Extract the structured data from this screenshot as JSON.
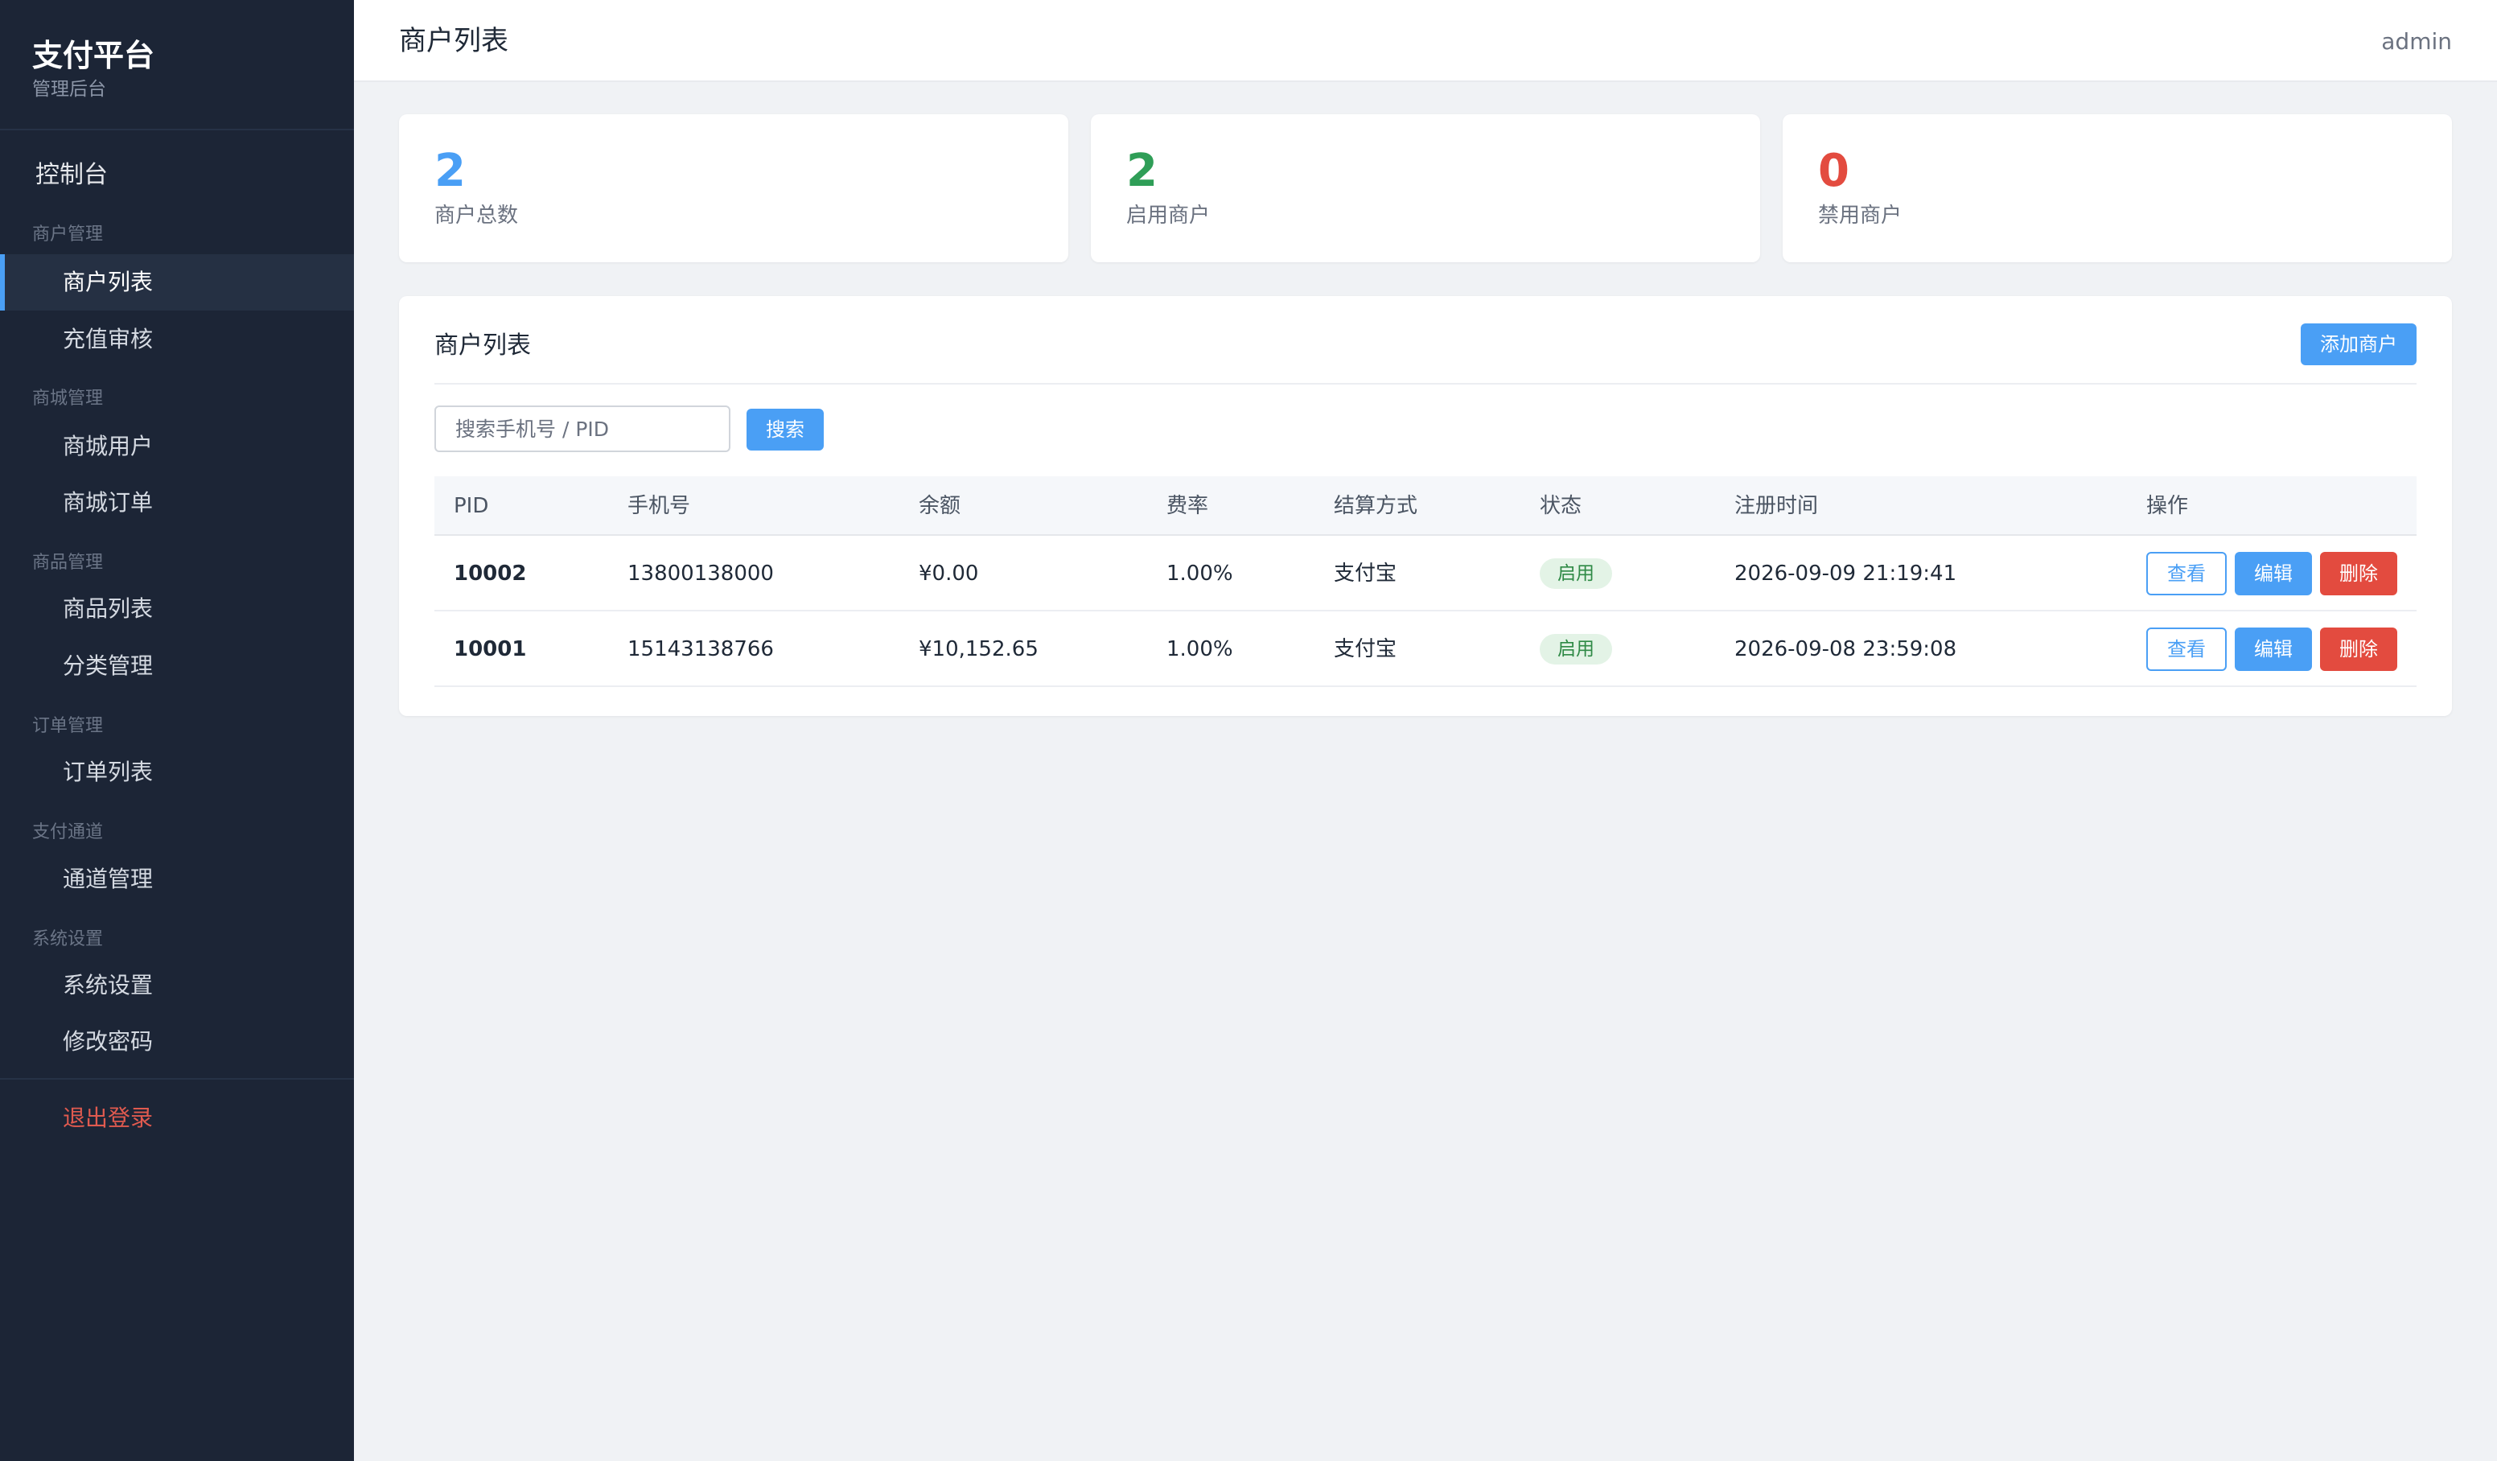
{
  "sidebar": {
    "brand_title": "支付平台",
    "brand_subtitle": "管理后台",
    "dashboard": "控制台",
    "groups": [
      {
        "title": "商户管理",
        "items": [
          "商户列表",
          "充值审核"
        ]
      },
      {
        "title": "商城管理",
        "items": [
          "商城用户",
          "商城订单"
        ]
      },
      {
        "title": "商品管理",
        "items": [
          "商品列表",
          "分类管理"
        ]
      },
      {
        "title": "订单管理",
        "items": [
          "订单列表"
        ]
      },
      {
        "title": "支付通道",
        "items": [
          "通道管理"
        ]
      },
      {
        "title": "系统设置",
        "items": [
          "系统设置",
          "修改密码"
        ]
      }
    ],
    "active_item": "商户列表",
    "logout": "退出登录"
  },
  "header": {
    "title": "商户列表",
    "user": "admin"
  },
  "stats": [
    {
      "value": "2",
      "label": "商户总数",
      "color": "#4a9ff5"
    },
    {
      "value": "2",
      "label": "启用商户",
      "color": "#2f9e57"
    },
    {
      "value": "0",
      "label": "禁用商户",
      "color": "#e34b3f"
    }
  ],
  "table_card": {
    "title": "商户列表",
    "add_button": "添加商户",
    "search_placeholder": "搜索手机号 / PID",
    "search_button": "搜索",
    "columns": [
      "PID",
      "手机号",
      "余额",
      "费率",
      "结算方式",
      "状态",
      "注册时间",
      "操作"
    ],
    "rows": [
      {
        "pid": "10002",
        "phone": "13800138000",
        "balance": "¥0.00",
        "rate": "1.00%",
        "settle": "支付宝",
        "status": "启用",
        "registered": "2026-09-09 21:19:41"
      },
      {
        "pid": "10001",
        "phone": "15143138766",
        "balance": "¥10,152.65",
        "rate": "1.00%",
        "settle": "支付宝",
        "status": "启用",
        "registered": "2026-09-08 23:59:08"
      }
    ],
    "actions": {
      "view": "查看",
      "edit": "编辑",
      "delete": "删除"
    }
  },
  "colors": {
    "accent": "#4a9ff5",
    "sidebar_bg": "#1c2536",
    "danger": "#e34b3f",
    "success": "#2f9e57"
  }
}
